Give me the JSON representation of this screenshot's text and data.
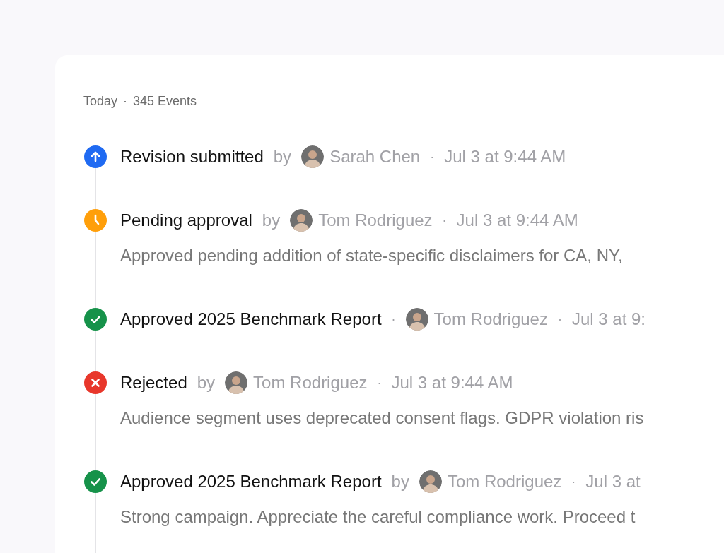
{
  "header": {
    "day": "Today",
    "separator": "·",
    "count": "345 Events"
  },
  "events": [
    {
      "kind": "submitted",
      "title": "Revision submitted",
      "connector": "by",
      "author": "Sarah Chen",
      "separator": "·",
      "time": "Jul 3 at 9:44 AM"
    },
    {
      "kind": "pending",
      "title": "Pending approval",
      "connector": "by",
      "author": "Tom Rodriguez",
      "separator": "·",
      "time": "Jul 3 at 9:44 AM",
      "description": "Approved pending addition of state-specific disclaimers for CA, NY,"
    },
    {
      "kind": "approved",
      "title": "Approved 2025 Benchmark Report",
      "connector": "·",
      "author": "Tom Rodriguez",
      "separator": "·",
      "time": "Jul 3 at 9:"
    },
    {
      "kind": "rejected",
      "title": "Rejected",
      "connector": "by",
      "author": "Tom Rodriguez",
      "separator": "·",
      "time": "Jul 3 at 9:44 AM",
      "description": "Audience segment uses deprecated consent flags. GDPR violation ris"
    },
    {
      "kind": "approved",
      "title": "Approved 2025 Benchmark Report",
      "connector": "by",
      "author": "Tom Rodriguez",
      "separator": "·",
      "time": "Jul 3 at",
      "description": "Strong campaign. Appreciate the careful compliance work. Proceed t"
    }
  ]
}
